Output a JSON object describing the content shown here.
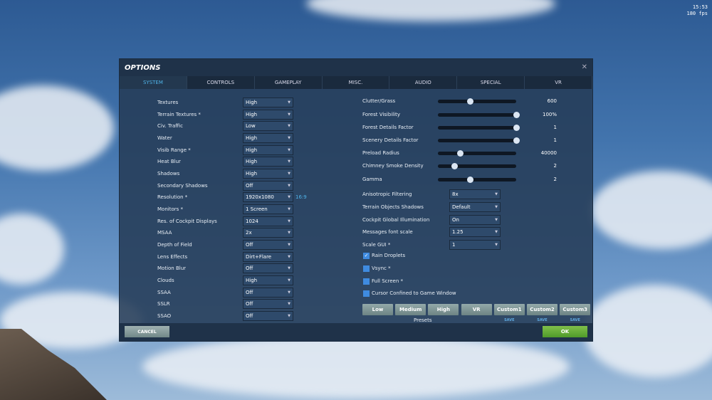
{
  "hud": {
    "time": "15:53",
    "fps": "180 fps"
  },
  "dialog": {
    "title": "OPTIONS",
    "close_icon": "close-icon"
  },
  "tabs": [
    "SYSTEM",
    "CONTROLS",
    "GAMEPLAY",
    "MISC.",
    "AUDIO",
    "SPECIAL",
    "VR"
  ],
  "active_tab": "SYSTEM",
  "left_settings": [
    {
      "label": "Textures",
      "value": "High"
    },
    {
      "label": "Terrain Textures *",
      "value": "High"
    },
    {
      "label": "Civ. Traffic",
      "value": "Low"
    },
    {
      "label": "Water",
      "value": "High"
    },
    {
      "label": "Visib Range *",
      "value": "High"
    },
    {
      "label": "Heat Blur",
      "value": "High"
    },
    {
      "label": "Shadows",
      "value": "High"
    },
    {
      "label": "Secondary Shadows",
      "value": "Off"
    },
    {
      "label": "Resolution *",
      "value": "1920x1080",
      "extra": "16:9"
    },
    {
      "label": "Monitors *",
      "value": "1 Screen"
    },
    {
      "label": "Res. of Cockpit Displays",
      "value": "1024"
    },
    {
      "label": "MSAA",
      "value": "2x"
    },
    {
      "label": "Depth of Field",
      "value": "Off"
    },
    {
      "label": "Lens Effects",
      "value": "Dirt+Flare"
    },
    {
      "label": "Motion Blur",
      "value": "Off"
    },
    {
      "label": "Clouds",
      "value": "High"
    },
    {
      "label": "SSAA",
      "value": "Off"
    },
    {
      "label": "SSLR",
      "value": "Off"
    },
    {
      "label": "SSAO",
      "value": "Off"
    }
  ],
  "sliders": [
    {
      "label": "Clutter/Grass",
      "value": "600",
      "fraction": 0.41
    },
    {
      "label": "Forest Visibility",
      "value": "100%",
      "fraction": 1.0
    },
    {
      "label": "Forest Details Factor",
      "value": "1",
      "fraction": 1.0
    },
    {
      "label": "Scenery Details Factor",
      "value": "1",
      "fraction": 1.0
    },
    {
      "label": "Preload Radius",
      "value": "40000",
      "fraction": 0.28
    },
    {
      "label": "Chimney Smoke Density",
      "value": "2",
      "fraction": 0.21
    },
    {
      "label": "Gamma",
      "value": "2",
      "fraction": 0.41
    }
  ],
  "right_selects": [
    {
      "label": "Anisotropic Filtering",
      "value": "8x"
    },
    {
      "label": "Terrain Objects Shadows",
      "value": "Default"
    },
    {
      "label": "Cockpit Global Illumination",
      "value": "On"
    },
    {
      "label": "Messages font scale",
      "value": "1.25"
    },
    {
      "label": "Scale GUI *",
      "value": "1"
    }
  ],
  "checkboxes": [
    {
      "label": "Rain Droplets",
      "checked": true
    },
    {
      "label": "Vsync *",
      "checked": false
    },
    {
      "label": "Full Screen *",
      "checked": false
    },
    {
      "label": "Cursor Confined to Game Window",
      "checked": false
    }
  ],
  "presets": {
    "label": "Presets",
    "buttons": [
      "Low",
      "Medium",
      "High",
      "VR",
      "Custom1",
      "Custom2",
      "Custom3"
    ],
    "save_label": "SAVE"
  },
  "footer": {
    "cancel": "CANCEL",
    "ok": "OK"
  }
}
